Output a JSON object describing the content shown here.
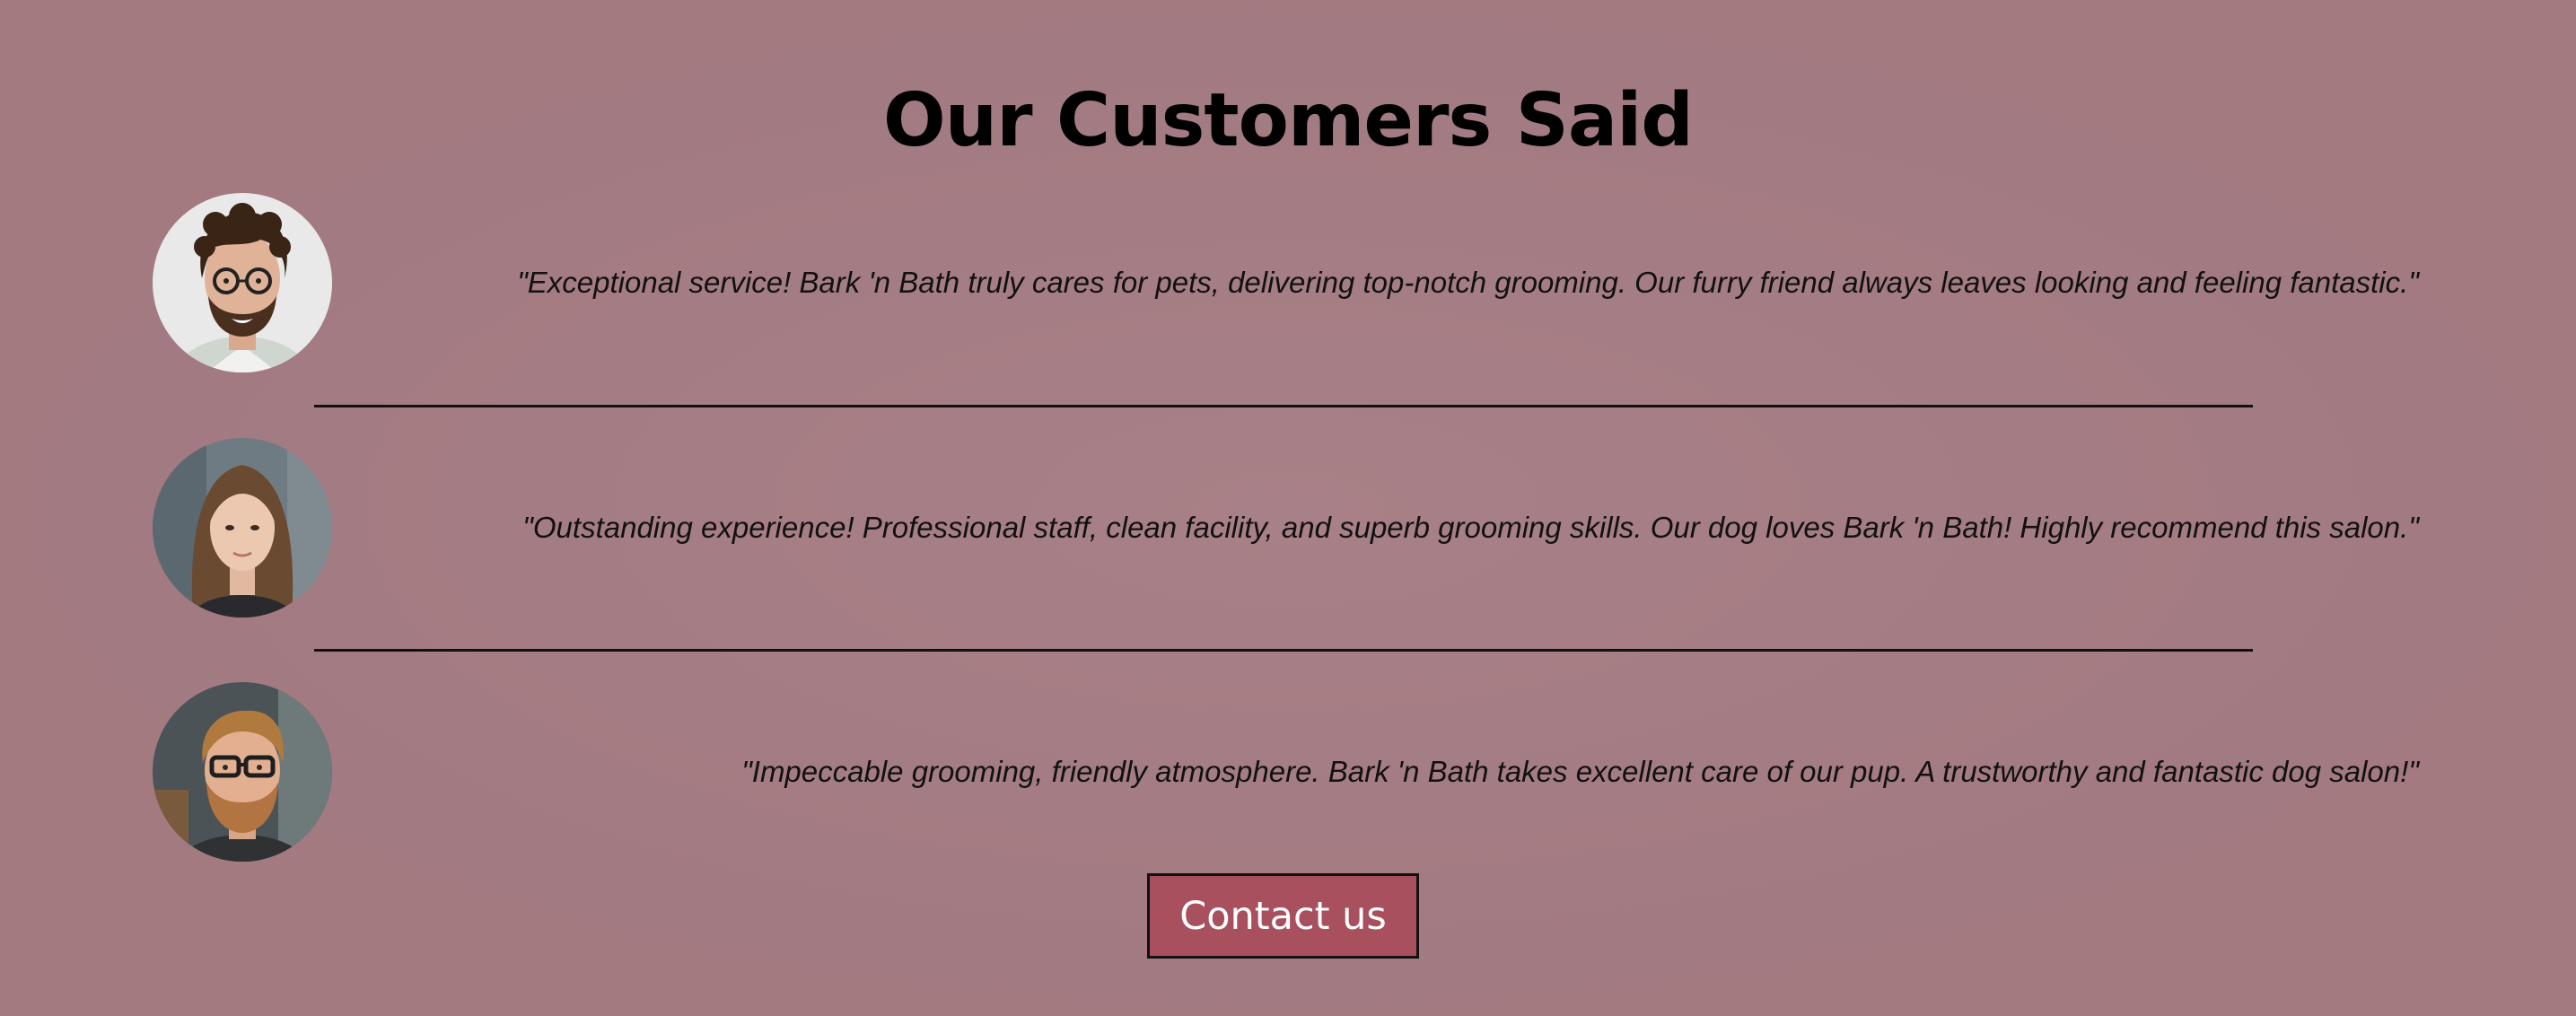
{
  "section": {
    "title": "Our Customers Said"
  },
  "testimonials": [
    {
      "quote": "\"Exceptional service! Bark 'n Bath truly cares for pets, delivering top-notch grooming. Our furry friend always leaves looking and feeling fantastic.\""
    },
    {
      "quote": "\"Outstanding experience! Professional staff, clean facility, and superb grooming skills. Our dog loves Bark 'n Bath! Highly recommend this salon.\""
    },
    {
      "quote": "\"Impeccable grooming, friendly atmosphere. Bark 'n Bath takes excellent care of our pup. A trustworthy and fantastic dog salon!\""
    }
  ],
  "contact_button": {
    "label": "Contact us"
  },
  "colors": {
    "background": "#a57c83",
    "button": "#a9505f",
    "button_text": "#ffffff",
    "text": "#000000"
  }
}
